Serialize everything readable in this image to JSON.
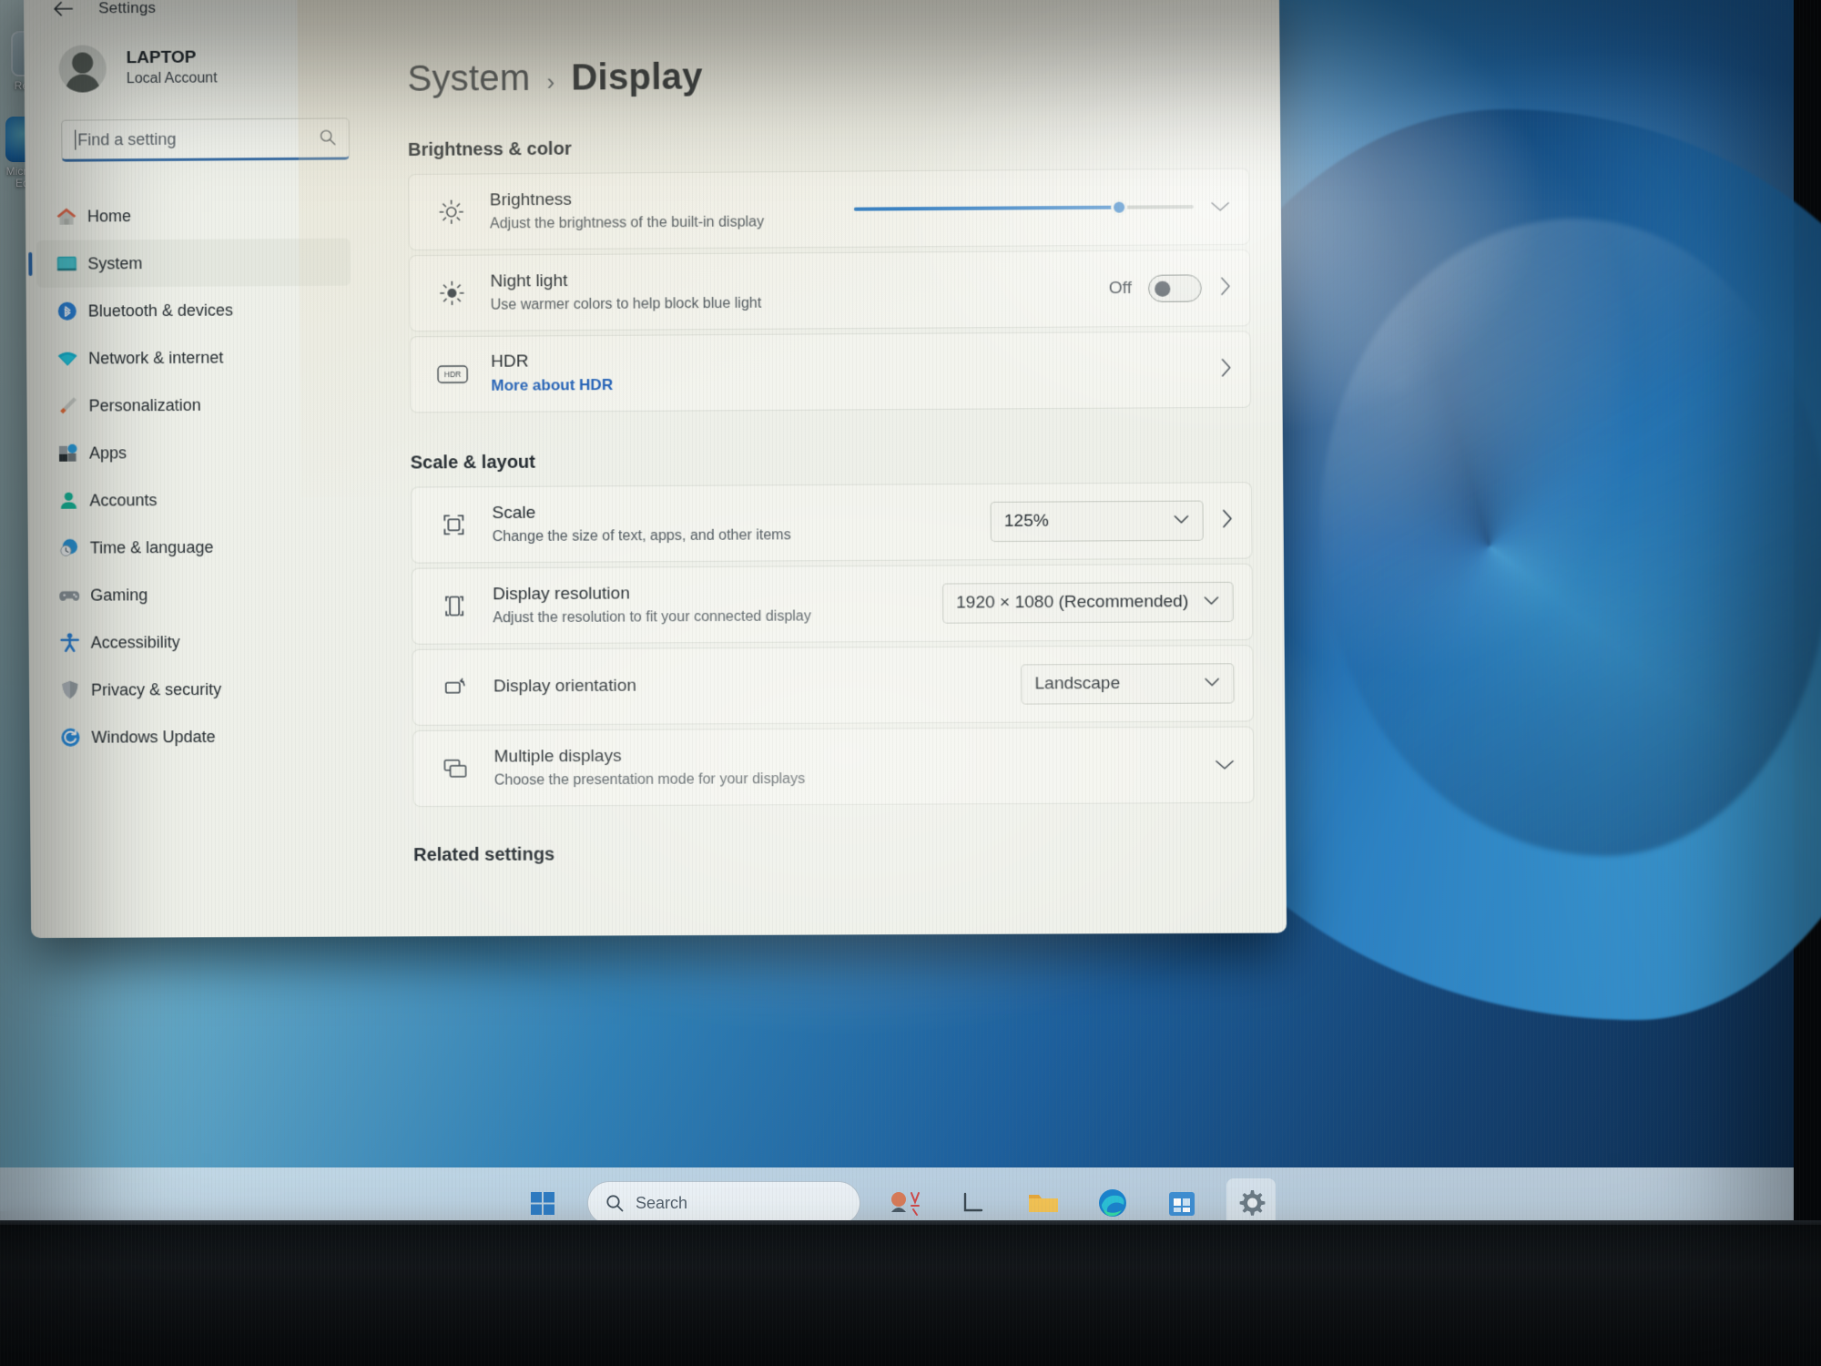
{
  "window": {
    "title": "Settings",
    "back_icon": "arrow-left-icon"
  },
  "account": {
    "name": "LAPTOP",
    "type": "Local Account",
    "avatar_icon": "user-avatar-icon"
  },
  "search": {
    "placeholder": "Find a setting",
    "icon": "search-icon"
  },
  "sidebar": {
    "items": [
      {
        "label": "Home",
        "icon": "home-icon",
        "selected": false
      },
      {
        "label": "System",
        "icon": "monitor-icon",
        "selected": true
      },
      {
        "label": "Bluetooth & devices",
        "icon": "bluetooth-icon",
        "selected": false
      },
      {
        "label": "Network & internet",
        "icon": "wifi-icon",
        "selected": false
      },
      {
        "label": "Personalization",
        "icon": "paintbrush-icon",
        "selected": false
      },
      {
        "label": "Apps",
        "icon": "apps-icon",
        "selected": false
      },
      {
        "label": "Accounts",
        "icon": "account-icon",
        "selected": false
      },
      {
        "label": "Time & language",
        "icon": "clock-globe-icon",
        "selected": false
      },
      {
        "label": "Gaming",
        "icon": "gamepad-icon",
        "selected": false
      },
      {
        "label": "Accessibility",
        "icon": "accessibility-icon",
        "selected": false
      },
      {
        "label": "Privacy & security",
        "icon": "shield-icon",
        "selected": false
      },
      {
        "label": "Windows Update",
        "icon": "update-icon",
        "selected": false
      }
    ]
  },
  "breadcrumb": {
    "parent": "System",
    "separator": "›",
    "current": "Display"
  },
  "sections": {
    "brightness_color": {
      "heading": "Brightness & color",
      "brightness": {
        "title": "Brightness",
        "subtitle": "Adjust the brightness of the built-in display",
        "icon": "brightness-icon",
        "value_percent": 78,
        "expand_icon": "chevron-down-icon"
      },
      "night_light": {
        "title": "Night light",
        "subtitle": "Use warmer colors to help block blue light",
        "icon": "night-light-icon",
        "state_label": "Off",
        "toggle_on": false,
        "chevron_icon": "chevron-right-icon"
      },
      "hdr": {
        "title": "HDR",
        "link": "More about HDR",
        "icon": "hdr-icon",
        "chevron_icon": "chevron-right-icon"
      }
    },
    "scale_layout": {
      "heading": "Scale & layout",
      "scale": {
        "title": "Scale",
        "subtitle": "Change the size of text, apps, and other items",
        "icon": "scale-icon",
        "value": "125%",
        "dropdown_icon": "chevron-down-icon",
        "chevron_icon": "chevron-right-icon"
      },
      "display_resolution": {
        "title": "Display resolution",
        "subtitle": "Adjust the resolution to fit your connected display",
        "icon": "resolution-icon",
        "value": "1920 × 1080 (Recommended)",
        "dropdown_icon": "chevron-down-icon"
      },
      "display_orientation": {
        "title": "Display orientation",
        "subtitle": "",
        "icon": "orientation-icon",
        "value": "Landscape",
        "dropdown_icon": "chevron-down-icon"
      },
      "multiple_displays": {
        "title": "Multiple displays",
        "subtitle": "Choose the presentation mode for your displays",
        "icon": "multiple-displays-icon",
        "expand_icon": "chevron-down-icon"
      }
    },
    "related_settings": {
      "heading": "Related settings"
    }
  },
  "taskbar": {
    "start_label": "Start",
    "search_placeholder": "Search",
    "items": [
      {
        "name": "start-button",
        "icon": "windows-logo-icon"
      },
      {
        "name": "search-box",
        "icon": "search-icon"
      },
      {
        "name": "widgets-button",
        "icon": "widgets-icon"
      },
      {
        "name": "task-view-button",
        "icon": "task-view-icon"
      },
      {
        "name": "file-explorer-button",
        "icon": "folder-icon"
      },
      {
        "name": "edge-button",
        "icon": "edge-icon"
      },
      {
        "name": "store-button",
        "icon": "store-icon"
      },
      {
        "name": "settings-button",
        "icon": "gear-icon"
      }
    ]
  },
  "desktop": {
    "icons": [
      {
        "label": "Recycle Bin",
        "icon": "recycle-bin-icon"
      },
      {
        "label": "Microsoft Edge",
        "icon": "edge-icon"
      }
    ]
  },
  "colors": {
    "accent": "#2e7cc4",
    "link": "#2060b8",
    "window_bg": "#eef0e9",
    "text": "#1f262c"
  }
}
